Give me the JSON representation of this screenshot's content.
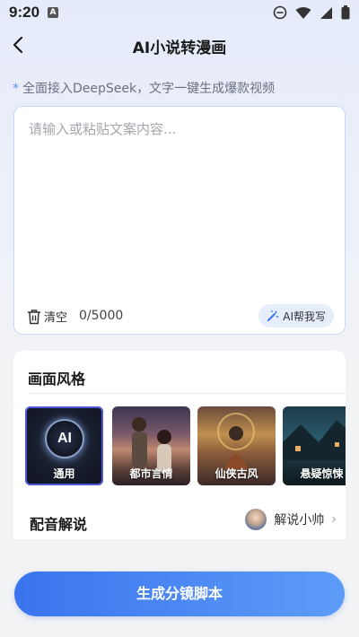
{
  "status_bar": {
    "time": "9:20",
    "notification_glyph": "A",
    "icons": [
      "do-not-disturb-icon",
      "wifi-icon",
      "signal-icon",
      "battery-icon"
    ]
  },
  "header": {
    "title": "AI小说转漫画",
    "back_icon": "chevron-left-icon"
  },
  "tip": {
    "marker": "*",
    "text": "全面接入DeepSeek，文字一键生成爆款视频"
  },
  "input": {
    "placeholder": "请输入或粘贴文案内容...",
    "value": "",
    "clear_label": "清空",
    "char_count": "0/5000",
    "ai_write_label": "AI帮我写"
  },
  "style_section": {
    "title": "画面风格",
    "selected_index": 0,
    "styles": [
      {
        "label": "通用",
        "badge": "AI"
      },
      {
        "label": "都市言情"
      },
      {
        "label": "仙侠古风"
      },
      {
        "label": "悬疑惊悚"
      }
    ]
  },
  "dubbing": {
    "title": "配音解说",
    "narrator_name": "解说小帅",
    "chevron": "›"
  },
  "primary_action": {
    "label": "生成分镜脚本"
  },
  "colors": {
    "accent": "#3a74ee",
    "accent_light": "#e6eefc",
    "selected_border": "#4e57d8",
    "tip_marker": "#5a8cf0"
  }
}
